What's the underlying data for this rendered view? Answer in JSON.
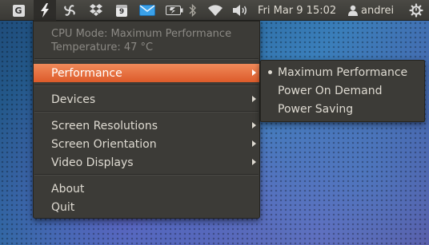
{
  "panel": {
    "indicators": [
      {
        "name": "g-indicator-icon",
        "glyph": "G"
      },
      {
        "name": "cpufreq-lightning-icon"
      },
      {
        "name": "pinwheel-icon"
      },
      {
        "name": "dropbox-icon"
      },
      {
        "name": "calendar-icon",
        "glyph": "9"
      },
      {
        "name": "mail-icon"
      },
      {
        "name": "battery-icon"
      },
      {
        "name": "bluetooth-icon"
      },
      {
        "name": "wifi-icon"
      },
      {
        "name": "volume-icon"
      }
    ],
    "clock": "Fri Mar  9 15:02",
    "user": "andrei",
    "accent": "#e8703a",
    "bg": "#3c3b37"
  },
  "menu": {
    "cpu_mode": "CPU Mode: Maximum Performance",
    "temperature": "Temperature: 47 °C",
    "items": [
      {
        "label": "Performance",
        "has_submenu": true,
        "highlighted": true
      },
      {
        "label": "Devices",
        "has_submenu": true
      },
      {
        "label": "Screen Resolutions",
        "has_submenu": true
      },
      {
        "label": "Screen Orientation",
        "has_submenu": true
      },
      {
        "label": "Video Displays",
        "has_submenu": true
      },
      {
        "label": "About",
        "has_submenu": false
      },
      {
        "label": "Quit",
        "has_submenu": false
      }
    ]
  },
  "submenu": {
    "items": [
      {
        "label": "Maximum Performance",
        "selected": true
      },
      {
        "label": "Power On Demand",
        "selected": false
      },
      {
        "label": "Power Saving",
        "selected": false
      }
    ]
  }
}
